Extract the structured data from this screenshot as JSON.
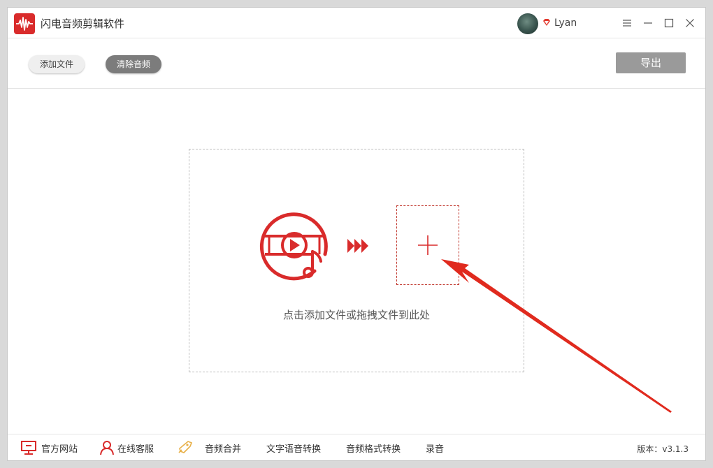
{
  "app": {
    "title": "闪电音频剪辑软件"
  },
  "user": {
    "name": "Lyan"
  },
  "toolbar": {
    "add_file": "添加文件",
    "clear_audio": "清除音频",
    "export": "导出"
  },
  "dropzone": {
    "hint": "点击添加文件或拖拽文件到此处"
  },
  "footer": {
    "items": [
      {
        "label": "官方网站",
        "icon": "monitor-icon"
      },
      {
        "label": "在线客服",
        "icon": "user-icon"
      },
      {
        "label": "音频合并",
        "icon": "rocket-icon"
      },
      {
        "label": "文字语音转换"
      },
      {
        "label": "音频格式转换"
      },
      {
        "label": "录音"
      }
    ],
    "version": "版本：v3.1.3"
  },
  "colors": {
    "accent": "#d92b2b",
    "export_disabled": "#9a9a9a",
    "clear_pill": "#7c7c7c"
  }
}
